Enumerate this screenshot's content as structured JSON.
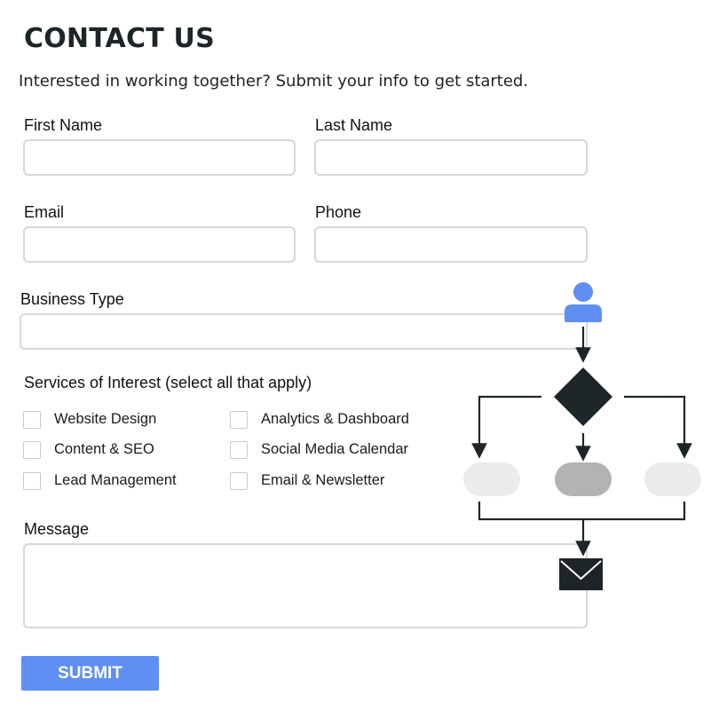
{
  "header": {
    "title": "CONTACT US",
    "subtitle": "Interested in working together? Submit your info to get started."
  },
  "form": {
    "first_name": {
      "label": "First Name",
      "value": ""
    },
    "last_name": {
      "label": "Last Name",
      "value": ""
    },
    "email": {
      "label": "Email",
      "value": ""
    },
    "phone": {
      "label": "Phone",
      "value": ""
    },
    "business_type": {
      "label": "Business Type",
      "value": ""
    },
    "services": {
      "label": "Services of Interest (select all that apply)",
      "options": [
        {
          "label": "Website Design",
          "checked": false
        },
        {
          "label": "Content & SEO",
          "checked": false
        },
        {
          "label": "Lead Management",
          "checked": false
        },
        {
          "label": "Analytics & Dashboard",
          "checked": false
        },
        {
          "label": "Social Media Calendar",
          "checked": false
        },
        {
          "label": "Email & Newsletter",
          "checked": false
        }
      ]
    },
    "message": {
      "label": "Message",
      "value": ""
    },
    "submit_label": "SUBMIT"
  },
  "illustration": {
    "icons": [
      "user-icon",
      "decision-diamond-icon",
      "envelope-icon"
    ],
    "colors": {
      "accent": "#5f8ff2",
      "dark": "#1e2528",
      "pill_light": "#ebebeb",
      "pill_mid": "#b3b3b3"
    }
  }
}
